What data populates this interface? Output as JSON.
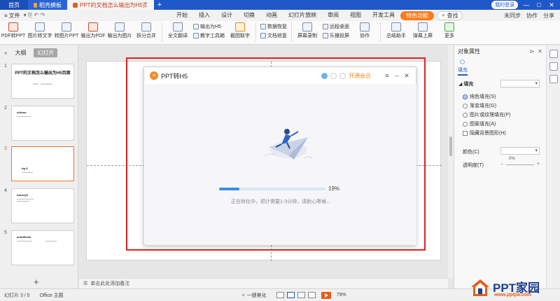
{
  "titlebar": {
    "tabs": [
      {
        "label": "首页"
      },
      {
        "label": "稻壳模板"
      },
      {
        "label": "PPT的文档怎么输出为H5页面"
      }
    ],
    "add_tab": "+",
    "login": "我的登录",
    "window_buttons": [
      "—",
      "□",
      "✕"
    ]
  },
  "menu": {
    "file_label": "文件",
    "tabs": [
      "开始",
      "插入",
      "设计",
      "切换",
      "动画",
      "幻灯片放映",
      "审阅",
      "视图",
      "开发工具"
    ],
    "accent_tab": "特色功能",
    "search_label": "查找",
    "right_items": [
      "未同步",
      "协作",
      "分享"
    ]
  },
  "ribbon": {
    "buttons": [
      {
        "label": "PDF转PPT"
      },
      {
        "label": "图片转文字"
      },
      {
        "label": "转图片PPT"
      },
      {
        "label": "输出为PDF"
      },
      {
        "label": "输出为图片"
      },
      {
        "label": "拆分合并"
      }
    ],
    "group2_big": "全文翻译",
    "group2_small": [
      "输出为H5",
      "教字工具箱"
    ],
    "group2_b": "截图取字",
    "group3_small": [
      "数据恢复",
      "文档修复"
    ],
    "group4_big": "屏幕录制",
    "group4_small": [
      "远程桌面",
      "乐播投屏"
    ],
    "group4_c": "协作",
    "group5": [
      "总结助手",
      "弹幕上屏",
      "更多"
    ]
  },
  "left_panel": {
    "tabs": [
      "大纲",
      "幻灯片"
    ],
    "slides": [
      {
        "num": "1",
        "title": "PPT的文档怎么输出为H5页面",
        "sub": "Public · Presentation"
      },
      {
        "num": "2",
        "title": "mikeas"
      },
      {
        "num": "3",
        "title": "ttq fi"
      },
      {
        "num": "4",
        "title": "basedyh"
      },
      {
        "num": "5",
        "title": "anbdfhsha"
      }
    ],
    "add": "+"
  },
  "notes": {
    "placeholder": "单击此处添加备注"
  },
  "dialog": {
    "title": "PPT转H5",
    "vip_link": "开通会员",
    "controls": [
      "≡",
      "–",
      "✕"
    ],
    "progress_percent": 19,
    "progress_label": "19%",
    "message": "正在转化中，预计需要1-3分钟，请耐心等候..."
  },
  "right_panel": {
    "title": "对象属性",
    "tab": "填充",
    "section": "填充",
    "options": [
      "纯色填充(S)",
      "渐变填充(G)",
      "图片或纹理填充(P)",
      "图案填充(A)"
    ],
    "hide_bg": "隐藏背景图形(H)",
    "color_label": "颜色(C)",
    "transparency_label": "透明度(T)",
    "transparency_value": "0%"
  },
  "statusbar": {
    "slide_pos": "幻灯片 3 / 5",
    "theme": "Office 主题",
    "beautify": "一键美化",
    "zoom": "79%"
  },
  "watermark": {
    "brand": "PPT家园",
    "url": "www.pptjia.com"
  },
  "colors": {
    "titlebar": "#1f58c8",
    "accent": "#ff7a1a",
    "highlight": "#e02020",
    "progress": "#3a8ee6"
  }
}
